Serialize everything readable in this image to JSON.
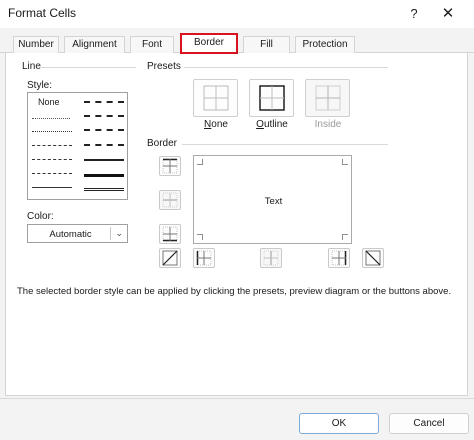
{
  "window": {
    "title": "Format Cells",
    "help_label": "?",
    "close_label": "✕"
  },
  "tabs": [
    {
      "label": "Number"
    },
    {
      "label": "Alignment"
    },
    {
      "label": "Font"
    },
    {
      "label": "Border",
      "selected": true
    },
    {
      "label": "Fill"
    },
    {
      "label": "Protection"
    }
  ],
  "line_group": {
    "title": "Line",
    "style_label": "Style:",
    "style_none": "None",
    "color_label": "Color:",
    "color_value": "Automatic"
  },
  "presets_group": {
    "title": "Presets",
    "presets": [
      {
        "label": "None",
        "underline": "N",
        "rest": "one"
      },
      {
        "label": "Outline",
        "underline": "O",
        "rest": "utline"
      },
      {
        "label": "Inside",
        "disabled": true
      }
    ]
  },
  "border_group": {
    "title": "Border",
    "preview_text": "Text"
  },
  "description": "The selected border style can be applied by clicking the presets, preview diagram or the buttons above.",
  "buttons": {
    "ok": "OK",
    "cancel": "Cancel"
  },
  "colors": {
    "tab_highlight": "#d8121f",
    "ok_border": "#7fa9d8"
  },
  "icons": {
    "close": "close-icon",
    "help": "help-icon",
    "dropdown": "chevron-down-icon"
  }
}
